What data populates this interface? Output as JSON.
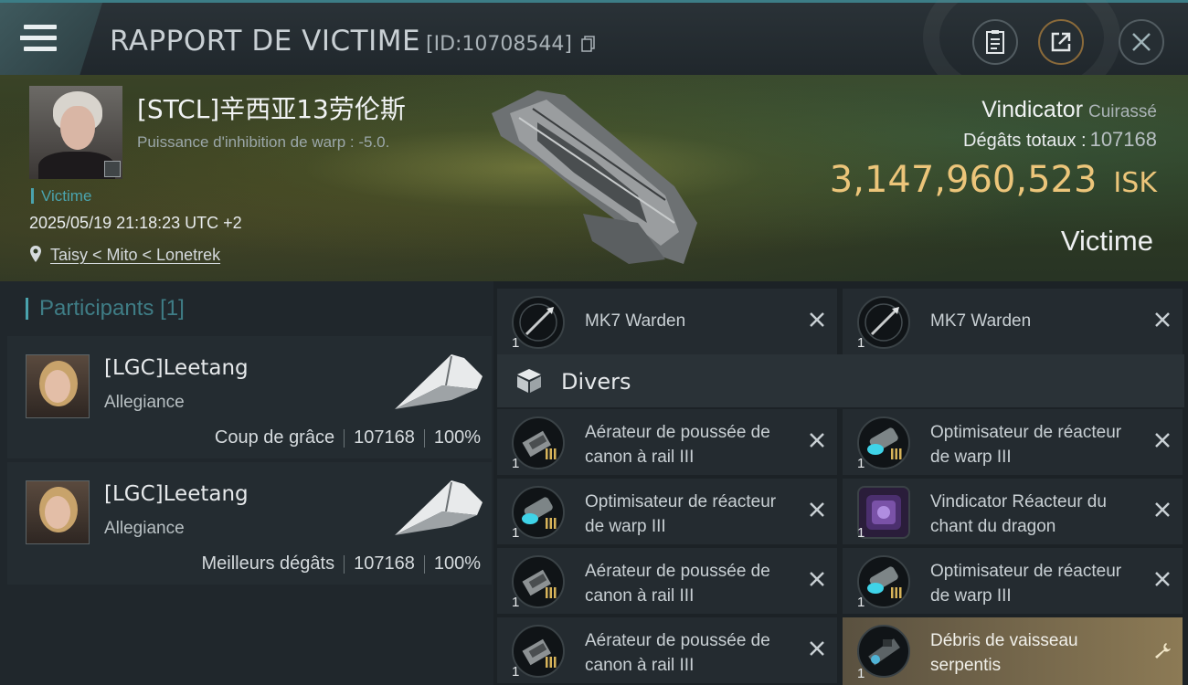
{
  "header": {
    "title": "RAPPORT DE VICTIME",
    "report_id": "[ID:10708544]"
  },
  "victim": {
    "name": "[STCL]辛西亚13劳伦斯",
    "subtitle": "Puissance d'inhibition de warp : -5.0.",
    "tag": "Victime",
    "datetime": "2025/05/19 21:18:23 UTC +2",
    "location": "Taisy < Mito < Lonetrek",
    "ship_name": "Vindicator",
    "ship_class": "Cuirassé",
    "damage_label": "Dégâts totaux :",
    "damage_value": "107168",
    "isk_value": "3,147,960,523",
    "isk_unit": "ISK",
    "role_label": "Victime"
  },
  "participants": {
    "header": "Participants",
    "count": "[1]",
    "cards": [
      {
        "name": "[LGC]Leetang",
        "alliance": "Allegiance",
        "stat_label": "Coup de grâce",
        "damage": "107168",
        "percent": "100%"
      },
      {
        "name": "[LGC]Leetang",
        "alliance": "Allegiance",
        "stat_label": "Meilleurs dégâts",
        "damage": "107168",
        "percent": "100%"
      }
    ]
  },
  "items": {
    "top_row": [
      {
        "label": "MK7 Warden",
        "qty": "1"
      },
      {
        "label": "MK7 Warden",
        "qty": "1"
      }
    ],
    "section_label": "Divers",
    "grid": [
      {
        "label": "Aérateur de poussée de canon à rail III",
        "qty": "1"
      },
      {
        "label": "Optimisateur de réacteur de warp III",
        "qty": "1"
      },
      {
        "label": "Optimisateur de réacteur de warp III",
        "qty": "1"
      },
      {
        "label": "Vindicator Réacteur du chant du dragon",
        "qty": "1"
      },
      {
        "label": "Aérateur de poussée de canon à rail III",
        "qty": "1"
      },
      {
        "label": "Optimisateur de réacteur de warp III",
        "qty": "1"
      },
      {
        "label": "Aérateur de poussée de canon à rail III",
        "qty": "1"
      },
      {
        "label": "Débris de vaisseau serpentis",
        "qty": "1"
      }
    ]
  },
  "colors": {
    "accent": "#4aa3ad",
    "isk": "#ecc57a",
    "highlight": "#8c7a55"
  },
  "icons": [
    "menu-icon",
    "copy-icon",
    "clipboard-icon",
    "share-icon",
    "close-icon",
    "pin-icon",
    "cube-icon",
    "wrench-icon"
  ]
}
